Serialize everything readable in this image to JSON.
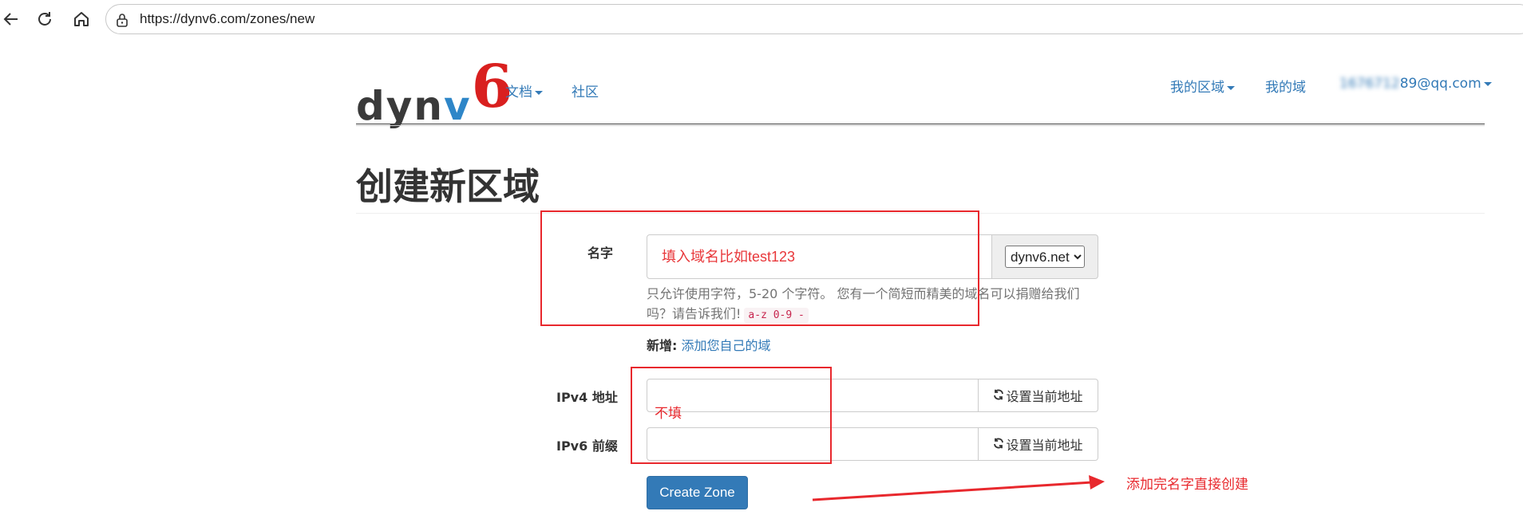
{
  "browser": {
    "url": "https://dynv6.com/zones/new"
  },
  "logo": {
    "part1": "dyn",
    "part2": "v",
    "part3": "6"
  },
  "nav": {
    "docs": "文档",
    "community": "社区",
    "my_zones": "我的区域",
    "my_domains": "我的域",
    "email_prefix": "1676712",
    "email_suffix": "89@qq.com"
  },
  "page": {
    "title": "创建新区域"
  },
  "form": {
    "name_label": "名字",
    "name_placeholder": "填入域名比如test123",
    "domain_options": [
      "dynv6.net"
    ],
    "domain_selected": "dynv6.net",
    "help_text": "只允许使用字符，5-20 个字符。 您有一个简短而精美的域名可以捐赠给我们吗？请告诉我们!",
    "help_code": "a-z 0-9 -",
    "new_prefix": "新增:",
    "new_link": "添加您自己的域",
    "ipv4_label": "IPv4 地址",
    "ipv6_label": "IPv6 前缀",
    "set_current_label": "设置当前地址",
    "submit_label": "Create Zone"
  },
  "annotations": {
    "skip_note": "不填",
    "create_note": "添加完名字直接创建"
  },
  "colors": {
    "link": "#337ab7",
    "primary": "#337ab7",
    "annotation": "#e8282d",
    "logo_v": "#2e86c8",
    "logo_6": "#d9201f"
  }
}
